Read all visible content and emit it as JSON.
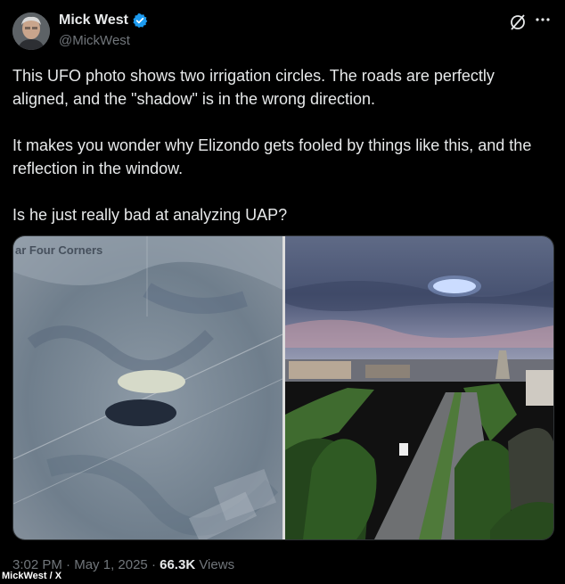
{
  "author": {
    "display_name": "Mick West",
    "handle": "@MickWest"
  },
  "post": {
    "paragraphs": [
      "This UFO photo shows two irrigation circles. The roads are perfectly aligned, and the \"shadow\" is in the wrong direction.",
      "It makes you wonder why Elizondo gets fooled by things like this, and the reflection in the window.",
      "Is he just really bad at analyzing UAP?"
    ]
  },
  "media": {
    "left_caption": "ar Four Corners"
  },
  "meta": {
    "time": "3:02 PM",
    "date": "May 1, 2025",
    "views_count": "66.3K",
    "views_label": "Views",
    "separator": "·"
  },
  "credit": "MickWest / X",
  "icons": [
    "verified-badge-icon",
    "grok-icon",
    "more-options-icon"
  ],
  "colors": {
    "background": "#000000",
    "text": "#e7e9ea",
    "muted": "#71767b",
    "verified": "#1d9bf0"
  }
}
